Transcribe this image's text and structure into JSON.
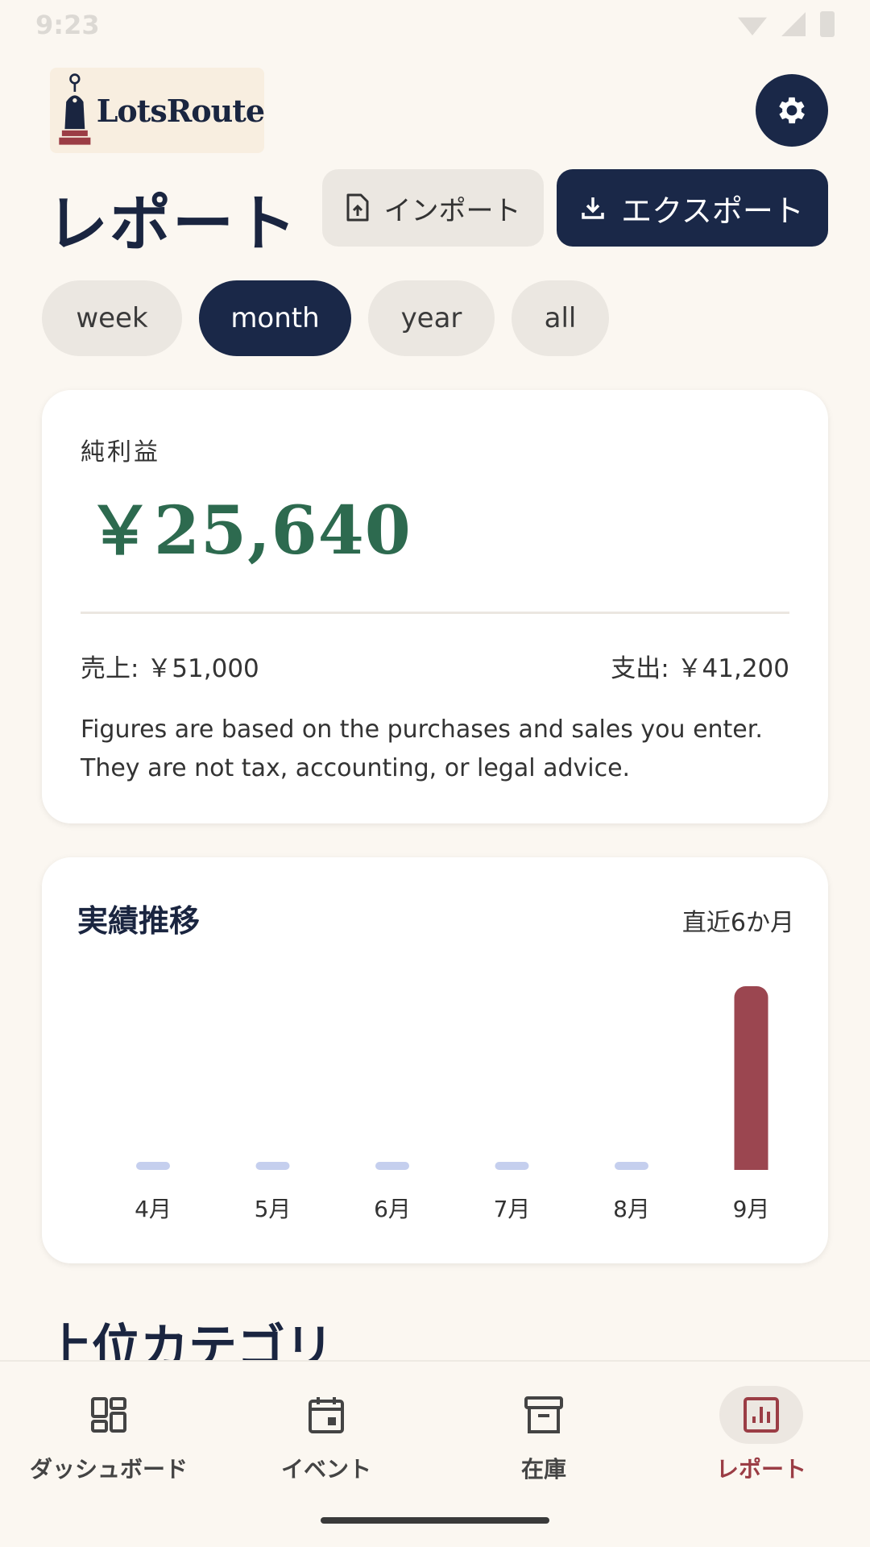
{
  "status_bar": {
    "time": "9:23",
    "signal": "97"
  },
  "header": {
    "logo_text": "LotsRoute",
    "settings_icon": "gear-icon"
  },
  "page": {
    "title": "レポート"
  },
  "actions": {
    "import_label": "インポート",
    "export_label": "エクスポート",
    "import_icon": "file-upload-icon",
    "export_icon": "download-icon"
  },
  "period_chips": [
    {
      "label": "week",
      "active": false
    },
    {
      "label": "month",
      "active": true
    },
    {
      "label": "year",
      "active": false
    },
    {
      "label": "all",
      "active": false
    }
  ],
  "profit_card": {
    "label": "純利益",
    "amount": "￥25,640",
    "sales": "売上: ￥51,000",
    "expenses": "支出: ￥41,200",
    "disclaimer": "Figures are based on the purchases and sales you enter. They are not tax, accounting, or legal advice."
  },
  "trend_card": {
    "title": "実績推移",
    "range_label": "直近6か月"
  },
  "chart_data": {
    "type": "bar",
    "categories": [
      "4月",
      "5月",
      "6月",
      "7月",
      "8月",
      "9月"
    ],
    "values": [
      0,
      0,
      0,
      0,
      0,
      25640
    ],
    "title": "実績推移",
    "xlabel": "",
    "ylabel": "",
    "colors": {
      "zero": "#c5cfee",
      "positive": "#9b4650"
    }
  },
  "section": {
    "top_categories_heading": "上位カテゴリ"
  },
  "bottom_nav": [
    {
      "label": "ダッシュボード",
      "icon": "dashboard-grid-icon",
      "active": false
    },
    {
      "label": "イベント",
      "icon": "calendar-icon",
      "active": false
    },
    {
      "label": "在庫",
      "icon": "archive-box-icon",
      "active": false
    },
    {
      "label": "レポート",
      "icon": "bar-chart-icon",
      "active": true
    }
  ],
  "colors": {
    "background": "#fbf7f1",
    "primary": "#1a2848",
    "profit_green": "#2d6a4f",
    "accent_red": "#9b3d45"
  }
}
